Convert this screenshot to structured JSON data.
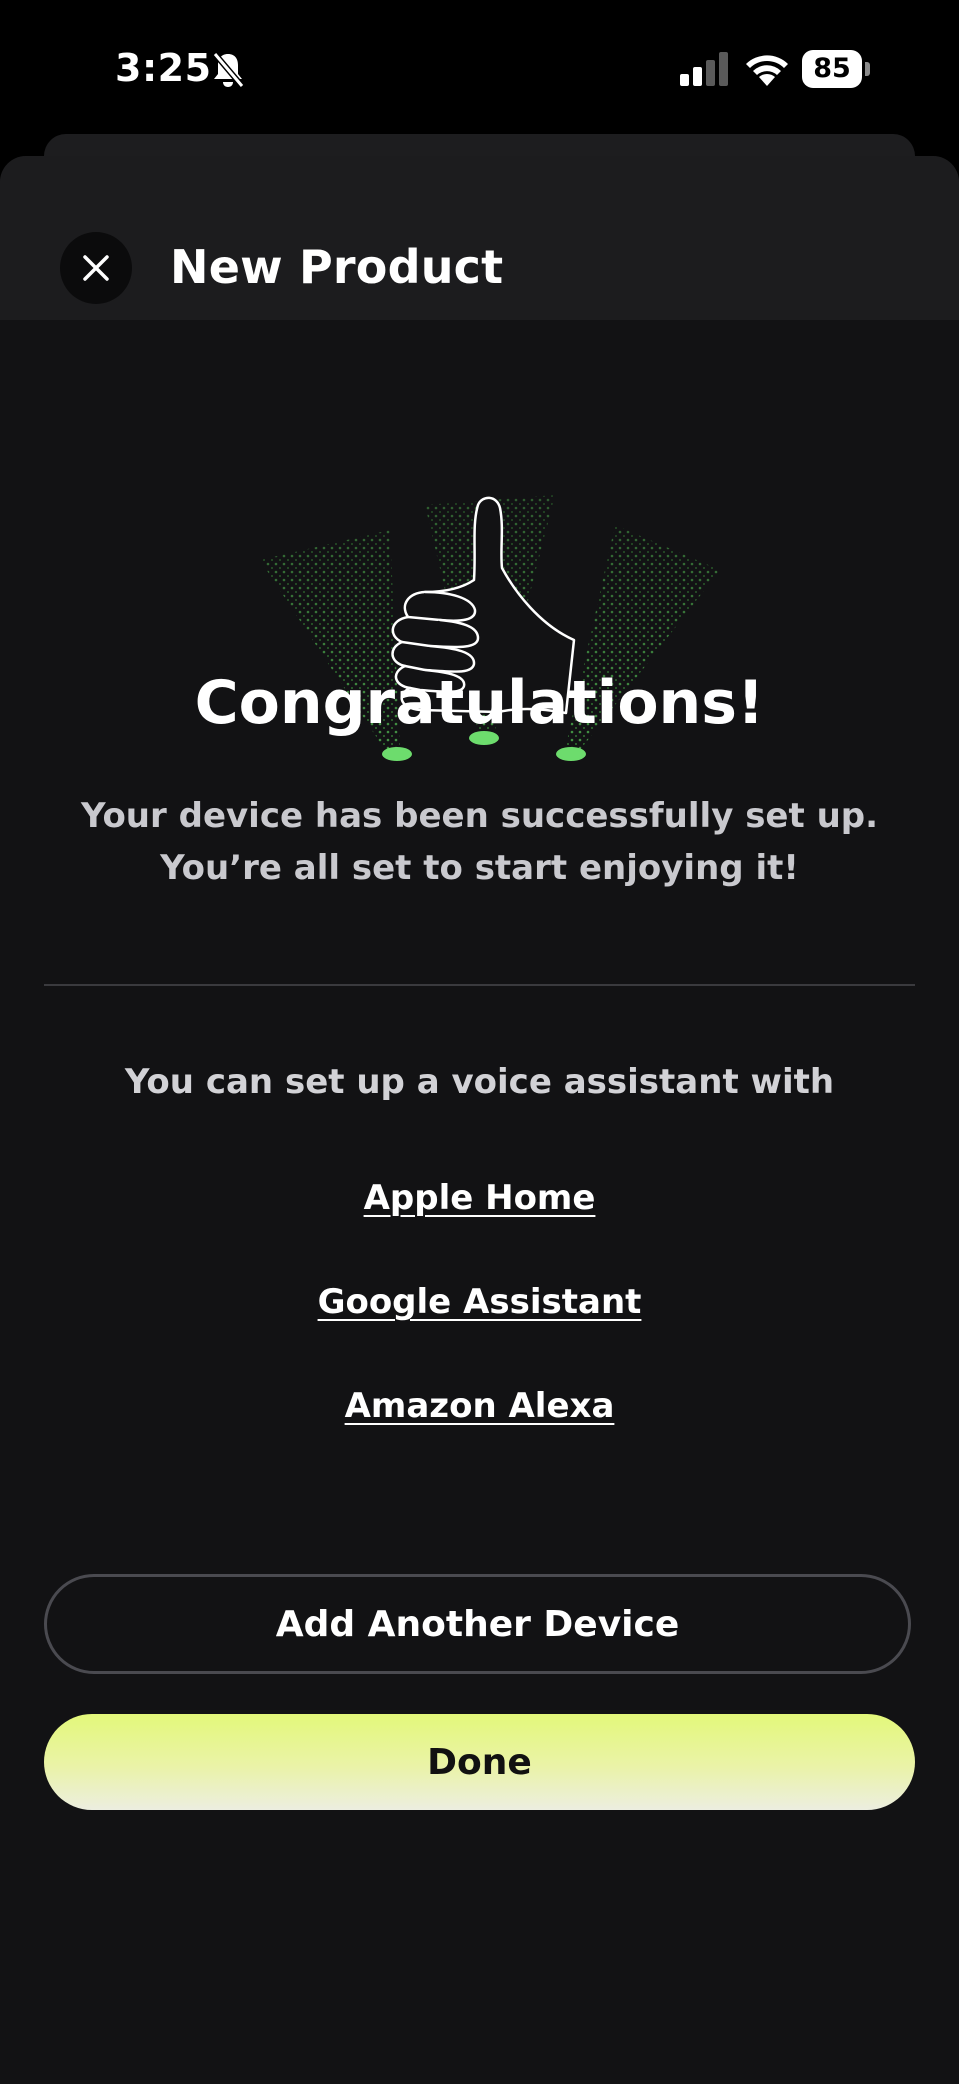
{
  "status_bar": {
    "time": "3:25",
    "battery": "85"
  },
  "header": {
    "title": "New Product"
  },
  "main": {
    "title": "Congratulations!",
    "message_line1": "Your device has been successfully set up.",
    "message_line2": "You’re all set to start enjoying it!",
    "voice_prompt": "You can set up a voice assistant with",
    "voice_links": [
      "Apple Home",
      "Google Assistant",
      "Amazon Alexa"
    ]
  },
  "actions": {
    "add_another": "Add Another Device",
    "done": "Done"
  },
  "colors": {
    "accent": "#e3f87a",
    "spot_green": "#6ddc6d",
    "sheet_bg": "#121214",
    "header_bg": "#1c1c1e"
  },
  "icons": {
    "close": "close-icon",
    "bell": "bell-slash-icon",
    "signal": "cellular-signal-icon",
    "wifi": "wifi-icon",
    "battery": "battery-icon",
    "illustration": "thumbs-up-icon"
  }
}
